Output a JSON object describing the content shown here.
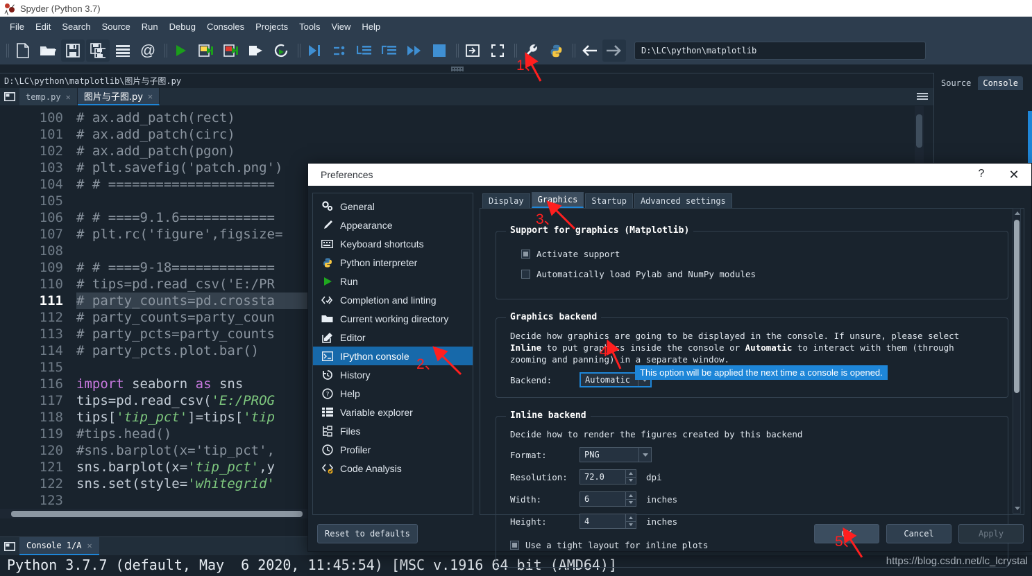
{
  "window": {
    "title": "Spyder (Python 3.7)",
    "logo_icon": "spyder-logo-icon"
  },
  "menubar": {
    "items": [
      {
        "label": "File"
      },
      {
        "label": "Edit"
      },
      {
        "label": "Search"
      },
      {
        "label": "Source"
      },
      {
        "label": "Run"
      },
      {
        "label": "Debug"
      },
      {
        "label": "Consoles"
      },
      {
        "label": "Projects"
      },
      {
        "label": "Tools"
      },
      {
        "label": "View"
      },
      {
        "label": "Help"
      }
    ]
  },
  "toolbar": {
    "path_value": "D:\\LC\\python\\matplotlib",
    "buttons": [
      {
        "name": "new-file-icon"
      },
      {
        "name": "open-file-icon"
      },
      {
        "name": "save-file-icon"
      },
      {
        "name": "save-all-icon"
      },
      {
        "name": "file-switcher-icon"
      },
      {
        "name": "find-symbol-icon"
      },
      {
        "name": "run-file-icon"
      },
      {
        "name": "run-cell-icon"
      },
      {
        "name": "run-cell-advance-icon"
      },
      {
        "name": "run-selection-icon"
      },
      {
        "name": "re-run-cell-icon"
      },
      {
        "name": "debug-file-icon"
      },
      {
        "name": "debug-step-over-icon"
      },
      {
        "name": "debug-step-into-icon"
      },
      {
        "name": "debug-step-return-icon"
      },
      {
        "name": "debug-continue-icon"
      },
      {
        "name": "debug-stop-icon"
      },
      {
        "name": "maximize-pane-icon"
      },
      {
        "name": "fullscreen-icon"
      },
      {
        "name": "preferences-wrench-icon"
      },
      {
        "name": "pythonpath-manager-icon"
      },
      {
        "name": "back-arrow-icon"
      },
      {
        "name": "forward-arrow-icon"
      }
    ]
  },
  "editor": {
    "file_path": "D:\\LC\\python\\matplotlib\\图片与子图.py",
    "tabs": [
      {
        "label": "temp.py",
        "active": false
      },
      {
        "label": "图片与子图.py",
        "active": true
      }
    ],
    "current_line": 111,
    "lines": [
      {
        "n": 100,
        "html": "<span class='cm'># ax.add_patch(rect)</span>"
      },
      {
        "n": 101,
        "html": "<span class='cm'># ax.add_patch(circ)</span>"
      },
      {
        "n": 102,
        "html": "<span class='cm'># ax.add_patch(pgon)</span>"
      },
      {
        "n": 103,
        "html": "<span class='cm'># plt.savefig('patch.png')</span>"
      },
      {
        "n": 104,
        "html": "<span class='cm'># # =====================</span>"
      },
      {
        "n": 105,
        "html": ""
      },
      {
        "n": 106,
        "html": "<span class='cm'># # ====9.1.6============</span>"
      },
      {
        "n": 107,
        "html": "<span class='cm'># plt.rc('figure',figsize=</span>"
      },
      {
        "n": 108,
        "html": ""
      },
      {
        "n": 109,
        "html": "<span class='cm'># # ====9-18=============</span>"
      },
      {
        "n": 110,
        "html": "<span class='cm'># tips=pd.read_csv('E:/PR</span>"
      },
      {
        "n": 111,
        "html": "<span class='cm'># party_counts=pd.crossta</span>"
      },
      {
        "n": 112,
        "html": "<span class='cm'># party_counts=party_coun</span>"
      },
      {
        "n": 113,
        "html": "<span class='cm'># party_pcts=party_counts</span>"
      },
      {
        "n": 114,
        "html": "<span class='cm'># party_pcts.plot.bar()</span>"
      },
      {
        "n": 115,
        "html": ""
      },
      {
        "n": 116,
        "html": "<span class='kw'>import</span> <span class='pl'>seaborn</span> <span class='kw'>as</span> <span class='pl'>sns</span>"
      },
      {
        "n": 117,
        "html": "<span class='pl'>tips=pd.read_csv(</span><span class='st'>'E:/PROG</span>"
      },
      {
        "n": 118,
        "html": "<span class='pl'>tips[</span><span class='st'>'tip_pct'</span><span class='pl'>]=tips[</span><span class='st'>'tip</span>"
      },
      {
        "n": 119,
        "html": "<span class='cm'>#tips.head()</span>"
      },
      {
        "n": 120,
        "html": "<span class='cm'>#sns.barplot(x='tip_pct',</span>"
      },
      {
        "n": 121,
        "html": "<span class='pl'>sns.barplot(x=</span><span class='st'>'tip_pct'</span><span class='pl'>,y</span>"
      },
      {
        "n": 122,
        "html": "<span class='pl'>sns.set(style=</span><span class='st'>'whitegrid'</span>"
      },
      {
        "n": 123,
        "html": ""
      }
    ]
  },
  "right_dock": {
    "tabs": [
      {
        "label": "Source",
        "active": false
      },
      {
        "label": "Console",
        "active": true
      }
    ]
  },
  "console": {
    "tabs": [
      {
        "label": "Console 1/A",
        "active": true
      }
    ],
    "output": "Python 3.7.7 (default, May  6 2020, 11:45:54) [MSC v.1916 64 bit (AMD64)]",
    "watermark": "https://blog.csdn.net/lc_lcrystal"
  },
  "preferences": {
    "title": "Preferences",
    "help_icon": "question-mark-icon",
    "close_icon": "close-icon",
    "sidebar": [
      {
        "label": "General",
        "icon": "gears-icon",
        "selected": false
      },
      {
        "label": "Appearance",
        "icon": "brush-icon",
        "selected": false
      },
      {
        "label": "Keyboard shortcuts",
        "icon": "keyboard-icon",
        "selected": false
      },
      {
        "label": "Python interpreter",
        "icon": "python-icon",
        "selected": false
      },
      {
        "label": "Run",
        "icon": "play-icon",
        "selected": false
      },
      {
        "label": "Completion and linting",
        "icon": "code-check-icon",
        "selected": false
      },
      {
        "label": "Current working directory",
        "icon": "folder-icon",
        "selected": false
      },
      {
        "label": "Editor",
        "icon": "pencil-square-icon",
        "selected": false
      },
      {
        "label": "IPython console",
        "icon": "terminal-icon",
        "selected": true
      },
      {
        "label": "History",
        "icon": "history-clock-icon",
        "selected": false
      },
      {
        "label": "Help",
        "icon": "question-circle-icon",
        "selected": false
      },
      {
        "label": "Variable explorer",
        "icon": "list-icon",
        "selected": false
      },
      {
        "label": "Files",
        "icon": "files-icon",
        "selected": false
      },
      {
        "label": "Profiler",
        "icon": "clock-icon",
        "selected": false
      },
      {
        "label": "Code Analysis",
        "icon": "code-analysis-icon",
        "selected": false
      }
    ],
    "tabs": [
      {
        "label": "Display",
        "active": false
      },
      {
        "label": "Graphics",
        "active": true
      },
      {
        "label": "Startup",
        "active": false
      },
      {
        "label": "Advanced settings",
        "active": false
      }
    ],
    "graphics_support": {
      "legend": "Support for graphics (Matplotlib)",
      "activate_support": {
        "label": "Activate support",
        "state": "partial"
      },
      "auto_load": {
        "label": "Automatically load Pylab and NumPy modules",
        "state": "unchecked"
      }
    },
    "graphics_backend": {
      "legend": "Graphics backend",
      "description_pre": "Decide how graphics are going to be displayed in the console. If unsure, please select ",
      "description_b1": "Inline",
      "description_mid": " to put graphics inside the console or ",
      "description_b2": "Automatic",
      "description_post": " to interact with them (through zooming and panning) in a separate window.",
      "backend_label": "Backend:",
      "backend_value": "Automatic",
      "tooltip": "This option will be applied the next time a console is opened."
    },
    "inline_backend": {
      "legend": "Inline backend",
      "description": "Decide how to render the figures created by this backend",
      "format_label": "Format:",
      "format_value": "PNG",
      "resolution_label": "Resolution:",
      "resolution_value": "72.0",
      "resolution_unit": "dpi",
      "width_label": "Width:",
      "width_value": "6",
      "width_unit": "inches",
      "height_label": "Height:",
      "height_value": "4",
      "height_unit": "inches",
      "tight_layout": {
        "label": "Use a tight layout for inline plots",
        "state": "partial"
      }
    },
    "footer": {
      "reset": "Reset to defaults",
      "ok": "OK",
      "cancel": "Cancel",
      "apply": "Apply"
    }
  },
  "annotations": [
    {
      "id": "1",
      "label": "1、",
      "target": "preferences-wrench-icon"
    },
    {
      "id": "2",
      "label": "2、",
      "target": "sidebar-item-ipython-console"
    },
    {
      "id": "3",
      "label": "3、",
      "target": "tab-graphics"
    },
    {
      "id": "4",
      "label": "4",
      "target": "backend-combo"
    },
    {
      "id": "5",
      "label": "5、",
      "target": "ok-button"
    }
  ],
  "colors": {
    "accent": "#1e86d8",
    "annotation": "#ff1f1f",
    "background": "#19232d",
    "panel": "#2d3d4e"
  }
}
